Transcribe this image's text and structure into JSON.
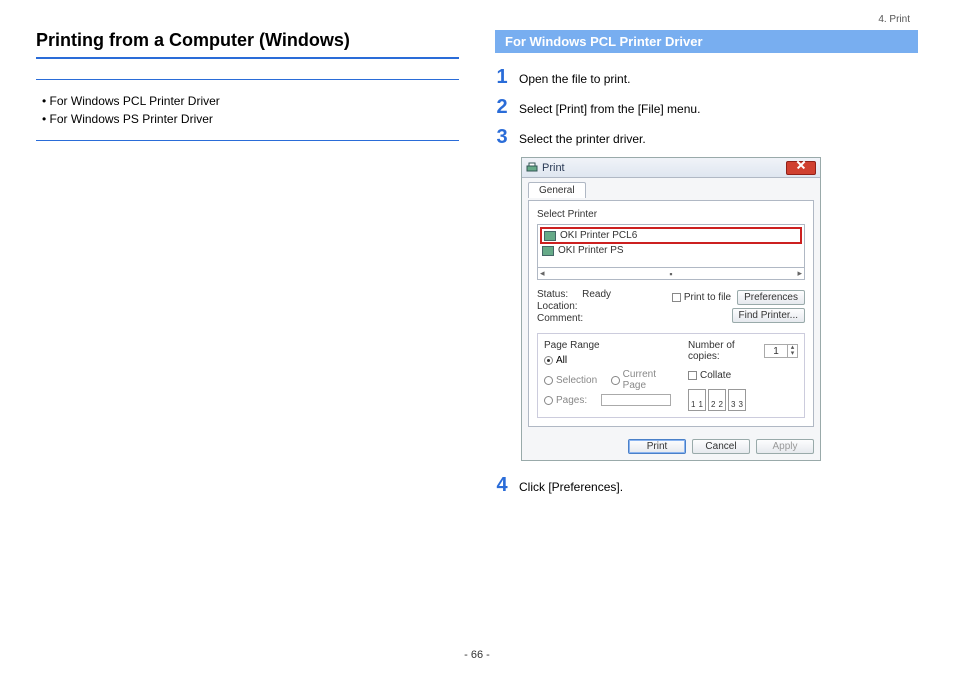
{
  "breadcrumb": "4. Print",
  "page_title": "Printing from a Computer (Windows)",
  "toc": {
    "items": [
      "For Windows PCL Printer Driver",
      "For Windows PS Printer Driver"
    ]
  },
  "section": {
    "title": "For Windows PCL Printer Driver",
    "steps": [
      "Open the file to print.",
      "Select [Print] from the [File] menu.",
      "Select the printer driver.",
      "Click [Preferences]."
    ]
  },
  "dialog": {
    "title": "Print",
    "tab": "General",
    "select_printer_label": "Select Printer",
    "printers": [
      "OKI Printer PCL6",
      "OKI Printer PS"
    ],
    "status_label": "Status:",
    "status_value": "Ready",
    "location_label": "Location:",
    "comment_label": "Comment:",
    "print_to_file": "Print to file",
    "preferences_btn": "Preferences",
    "find_printer_btn": "Find Printer...",
    "page_range_label": "Page Range",
    "range_all": "All",
    "range_selection": "Selection",
    "range_current": "Current Page",
    "range_pages": "Pages:",
    "copies_label": "Number of copies:",
    "copies_value": "1",
    "collate_label": "Collate",
    "collate_pages": [
      "1",
      "1",
      "2",
      "2",
      "3",
      "3"
    ],
    "btn_print": "Print",
    "btn_cancel": "Cancel",
    "btn_apply": "Apply"
  },
  "page_number": "- 66 -"
}
